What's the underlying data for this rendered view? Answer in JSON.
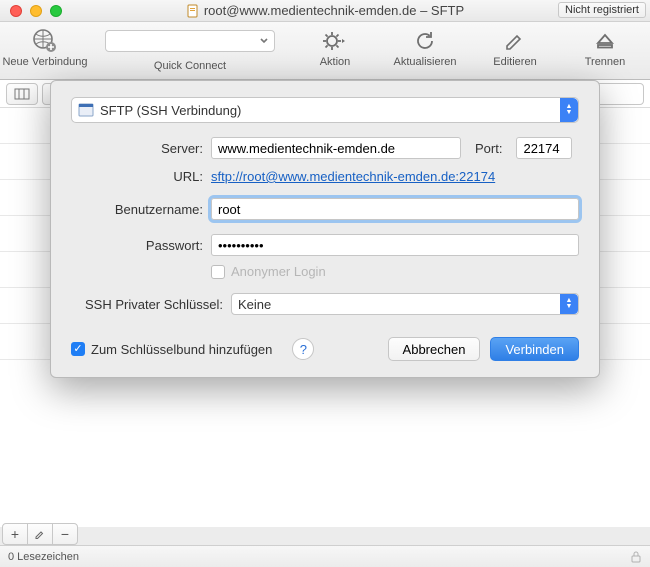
{
  "titlebar": {
    "title": "root@www.medientechnik-emden.de – SFTP",
    "not_registered": "Nicht registriert"
  },
  "toolbar": {
    "new_connection": "Neue Verbindung",
    "quick_connect_label": "Quick Connect",
    "quick_connect_value": "",
    "action": "Aktion",
    "refresh": "Aktualisieren",
    "edit": "Editieren",
    "disconnect": "Trennen"
  },
  "sheet": {
    "protocol": "SFTP (SSH Verbindung)",
    "labels": {
      "server": "Server:",
      "port": "Port:",
      "url": "URL:",
      "username": "Benutzername:",
      "password": "Passwort:",
      "anonymous": "Anonymer Login",
      "ssh_key": "SSH Privater Schlüssel:",
      "add_keychain": "Zum Schlüsselbund hinzufügen"
    },
    "values": {
      "server": "www.medientechnik-emden.de",
      "port": "22174",
      "url": "sftp://root@www.medientechnik-emden.de:22174",
      "username": "root",
      "password": "••••••••••",
      "ssh_key": "Keine"
    },
    "buttons": {
      "cancel": "Abbrechen",
      "connect": "Verbinden"
    }
  },
  "statusbar": {
    "bookmarks": "0 Lesezeichen"
  }
}
